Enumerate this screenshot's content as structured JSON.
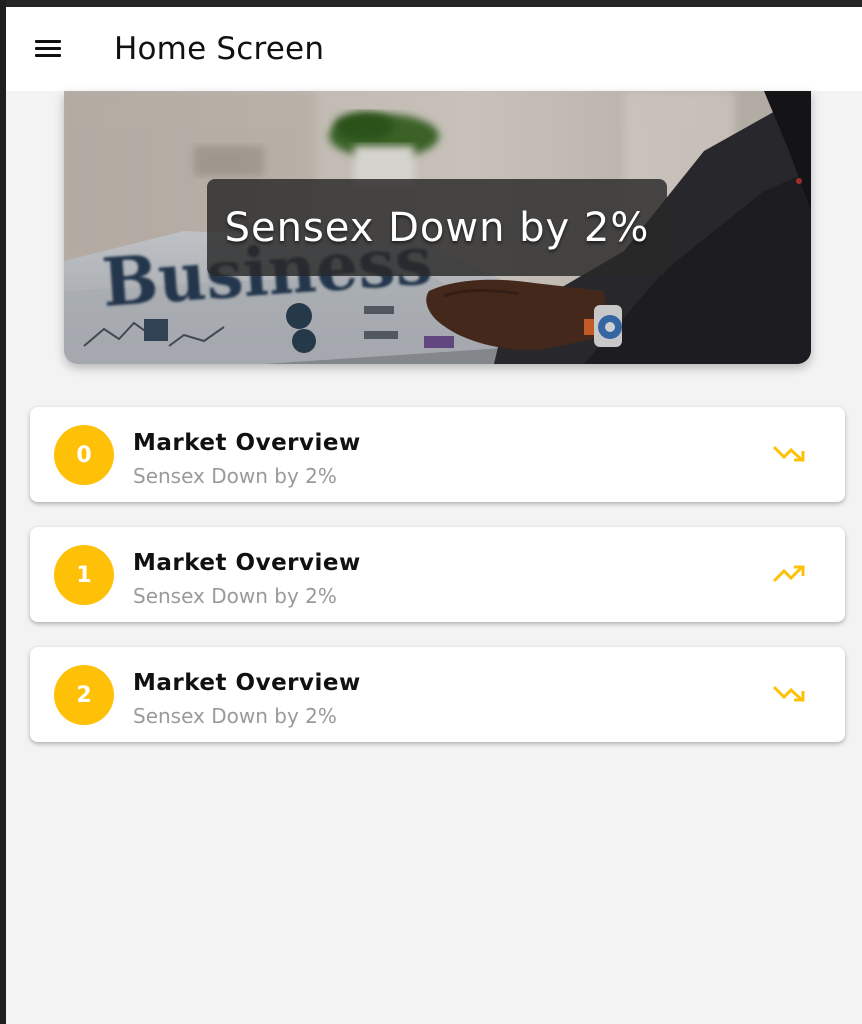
{
  "appbar": {
    "title": "Home Screen",
    "menu_icon": "menu-icon"
  },
  "banner": {
    "headline": "Sensex Down by 2%"
  },
  "news_list": [
    {
      "index": "0",
      "title": "Market Overview",
      "subtitle": "Sensex Down by 2%",
      "trend_icon": "trending-down-icon"
    },
    {
      "index": "1",
      "title": "Market Overview",
      "subtitle": "Sensex Down by 2%",
      "trend_icon": "trending-up-icon"
    },
    {
      "index": "2",
      "title": "Market Overview",
      "subtitle": "Sensex Down by 2%",
      "trend_icon": "trending-down-icon"
    }
  ],
  "colors": {
    "accent": "#ffc107",
    "background": "#f3f3f3",
    "card": "#ffffff"
  }
}
